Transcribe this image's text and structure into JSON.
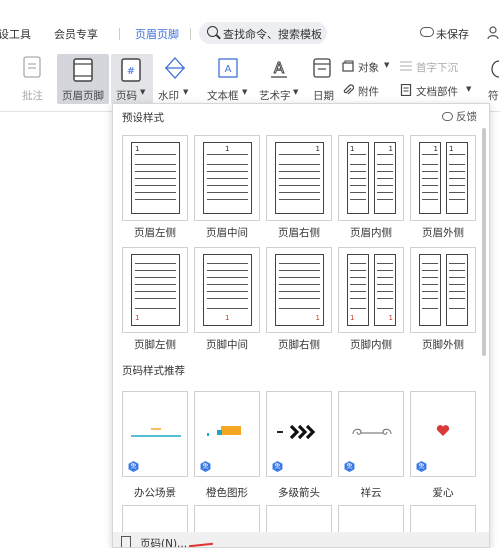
{
  "menubar": {
    "partial_left": "设工具",
    "member": "会员专享",
    "header_footer_tab": "页眉页脚",
    "search_placeholder": "查找命令、搜索模板",
    "unsaved": "未保存"
  },
  "ribbon": {
    "comment": "批注",
    "header_footer": "页眉页脚",
    "page_number": "页码",
    "watermark": "水印",
    "textbox": "文本框",
    "wordart": "艺术字",
    "date": "日期",
    "object": "对象",
    "dropcap": "首字下沉",
    "attachment": "附件",
    "doc_parts": "文档部件",
    "symbol_partial": "符"
  },
  "panel": {
    "preset_title": "预设样式",
    "feedback": "反馈",
    "header_presets": [
      "页眉左侧",
      "页眉中间",
      "页眉右侧",
      "页眉内侧",
      "页眉外侧"
    ],
    "footer_presets": [
      "页脚左侧",
      "页脚中间",
      "页脚右侧",
      "页脚内侧",
      "页脚外侧"
    ],
    "recommend_title": "页码样式推荐",
    "recommend": [
      "办公场景",
      "橙色图形",
      "多级箭头",
      "祥云",
      "爱心"
    ],
    "badge": "免",
    "sample_number": "1",
    "footer_item": "页码(N)..."
  },
  "colors": {
    "accent": "#3f6fd8",
    "badge": "#3a79e8",
    "heart": "#d9393b",
    "orange": "#f5a623",
    "teal": "#1ea7c5",
    "arrow": "#e0342f"
  }
}
